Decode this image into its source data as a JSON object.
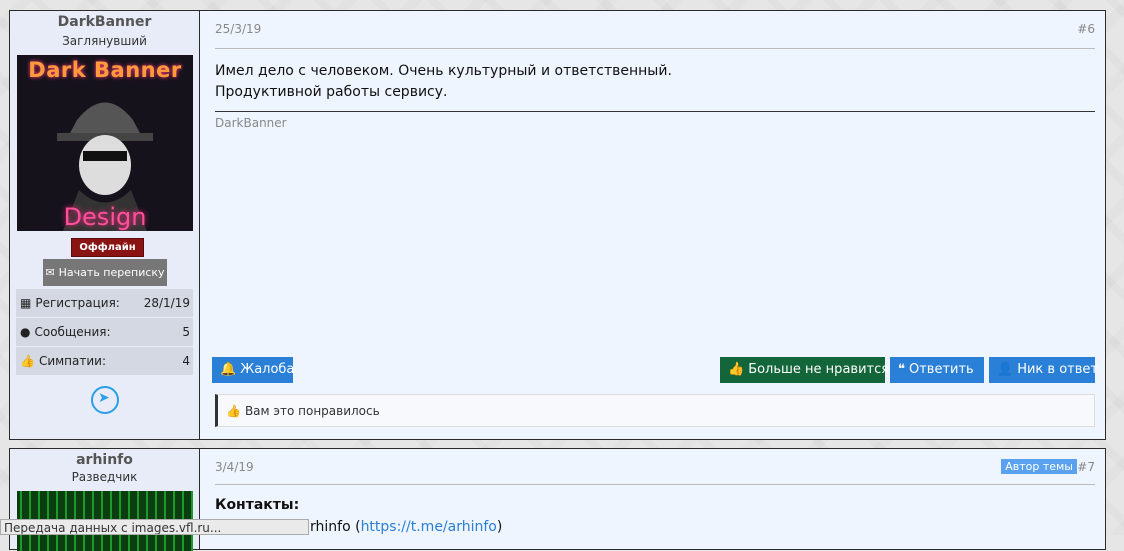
{
  "post1": {
    "username": "DarkBanner",
    "user_title": "Заглянувший",
    "avatar_text_top": "Dark Banner",
    "avatar_text_bottom": "Design",
    "status": "Оффлайн",
    "pm_button": "Начать переписку",
    "stats": [
      {
        "label": "Регистрация:",
        "value": "28/1/19",
        "icon": "calendar-icon"
      },
      {
        "label": "Сообщения:",
        "value": "5",
        "icon": "comment-icon"
      },
      {
        "label": "Симпатии:",
        "value": "4",
        "icon": "thumbs-up-icon"
      }
    ],
    "date": "25/3/19",
    "number": "#6",
    "message_lines": [
      "Имел дело с человеком. Очень культурный и ответственный.",
      "Продуктивной работы сервису."
    ],
    "signature": "DarkBanner",
    "buttons": {
      "report": "Жалоба",
      "unlike": "Больше не нравится",
      "reply": "Ответить",
      "nick_reply": "Ник в ответ"
    },
    "likes_text": "Вам это понравилось"
  },
  "post2": {
    "username": "arhinfo",
    "user_title": "Разведчик",
    "date": "3/4/19",
    "badge": "Автор темы",
    "number": "#7",
    "contacts_label": "Контакты:",
    "contacts_prefix": "rhinfo (",
    "contacts_link": "https://t.me/arhinfo",
    "contacts_suffix": ")"
  },
  "statusbar": "Передача данных с images.vfl.ru...",
  "colors": {
    "accent": "#2a7fd6",
    "green": "#13663a",
    "offline": "#8a1414"
  }
}
